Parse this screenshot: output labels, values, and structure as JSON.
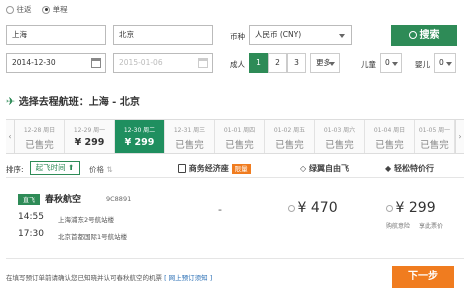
{
  "trip": {
    "oneway_label": "往返",
    "single_label": "单程"
  },
  "search": {
    "from": "上海",
    "to": "北京",
    "currency_label": "币种",
    "currency_value": "人民币 (CNY)",
    "search_button": "搜索",
    "depart_date": "2014-12-30",
    "return_date": "2015-01-06",
    "adult_label": "成人",
    "adult_options": [
      "1",
      "2",
      "3"
    ],
    "more_label": "更多",
    "child_label": "儿童",
    "child_value": "0",
    "infant_label": "婴儿",
    "infant_value": "0"
  },
  "section_title": "选择去程航班：上海 - 北京",
  "dates": [
    {
      "date": "12-28 周日",
      "status": "已售完"
    },
    {
      "date": "12-29 周一",
      "status": "¥ 299"
    },
    {
      "date": "12-30 周二",
      "status": "¥ 299"
    },
    {
      "date": "12-31 周三",
      "status": "已售完"
    },
    {
      "date": "01-01 周四",
      "status": "已售完"
    },
    {
      "date": "01-02 周五",
      "status": "已售完"
    },
    {
      "date": "01-03 周六",
      "status": "已售完"
    },
    {
      "date": "01-04 周日",
      "status": "已售完"
    },
    {
      "date": "01-05 周一",
      "status": "已售完"
    }
  ],
  "sort": {
    "label": "排序:",
    "depart_time": "起飞时间",
    "price": "价格",
    "business_economy": "商务经济座",
    "business_badge": "限量",
    "green_wing": "绿翼自由飞",
    "easy_fare": "轻松特价行"
  },
  "flight": {
    "tag": "直飞",
    "airline": "春秋航空",
    "number": "9C8891",
    "dep_time": "14:55",
    "dep_airport": "上海浦东2号航站楼",
    "arr_time": "17:30",
    "arr_airport": "北京首都国际1号航站楼",
    "business_price": "-",
    "green_price": "¥ 470",
    "easy_price": "¥ 299",
    "easy_note_1": "购航意险",
    "easy_note_2": "享此票价"
  },
  "footer": {
    "notice": "在填写预订单前请确认您已知晓并认可春秋航空的机票",
    "link": "[ 网上预订须知 ]",
    "next_button": "下一步"
  },
  "colors": {
    "accent": "#2e8b57",
    "date_selected": "#1f8f5f",
    "next": "#f07c1f",
    "badge": "#f07c1f"
  }
}
